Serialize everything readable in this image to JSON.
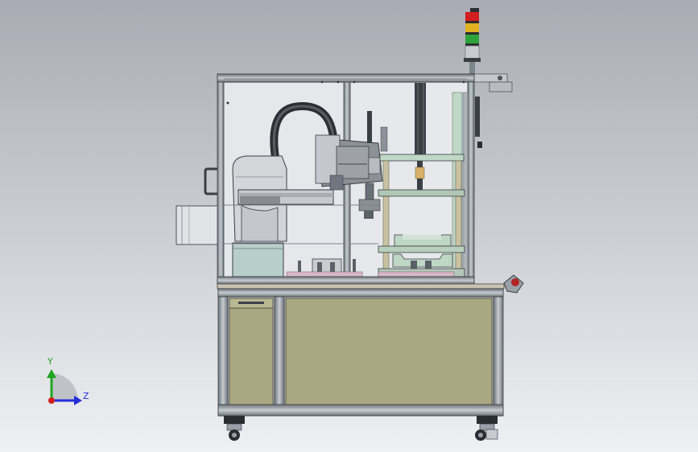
{
  "viewport": {
    "background_gradient": [
      "#a9abb4",
      "#eff0f3"
    ]
  },
  "triad": {
    "y_label": "Y",
    "z_label": "Z",
    "colors": {
      "y": "#1fa51f",
      "z": "#2330d8",
      "origin": "#d21e1e"
    }
  },
  "colors": {
    "frame": "#8f949c",
    "frame_dark": "#3a3e45",
    "glass": "#dcdfe4",
    "table_top": "#c9c2b3",
    "cabinet_panel": "#a9a882",
    "robot_body": "#d3d5d8",
    "robot_base": "#b7cfc8",
    "gantry_green": "#bfd7c5",
    "tower_red": "#d21e1e",
    "tower_yellow": "#e0b020",
    "tower_green": "#2ea33a",
    "cable": "#2c2f33"
  }
}
